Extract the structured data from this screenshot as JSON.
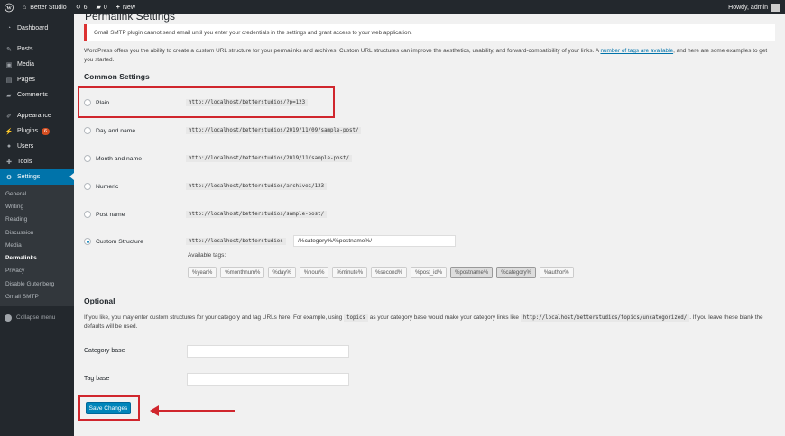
{
  "adminbar": {
    "site_name": "Better Studio",
    "updates_count": "6",
    "comments_count": "0",
    "new_label": "New",
    "howdy": "Howdy, admin"
  },
  "sidebar": {
    "items_top": [
      {
        "label": "Dashboard",
        "icon": "dashboard-icon"
      }
    ],
    "items_mid": [
      {
        "label": "Posts",
        "icon": "pin-icon"
      },
      {
        "label": "Media",
        "icon": "media-icon"
      },
      {
        "label": "Pages",
        "icon": "page-icon"
      },
      {
        "label": "Comments",
        "icon": "comment-icon"
      }
    ],
    "items_bottom": [
      {
        "label": "Appearance",
        "icon": "brush-icon"
      },
      {
        "label": "Plugins",
        "icon": "plugin-icon",
        "badge": "6"
      },
      {
        "label": "Users",
        "icon": "user-icon"
      },
      {
        "label": "Tools",
        "icon": "wrench-icon"
      },
      {
        "label": "Settings",
        "icon": "settings-icon"
      }
    ],
    "submenu": [
      "General",
      "Writing",
      "Reading",
      "Discussion",
      "Media",
      "Permalinks",
      "Privacy",
      "Disable Gutenberg",
      "Gmail SMTP"
    ],
    "current_submenu": "Permalinks",
    "collapse_label": "Collapse menu"
  },
  "content": {
    "title": "Permalink Settings",
    "notice": "Gmail SMTP plugin cannot send email until you enter your credentials in the settings and grant access to your web application.",
    "intro_before_link": "WordPress offers you the ability to create a custom URL structure for your permalinks and archives. Custom URL structures can improve the aesthetics, usability, and forward-compatibility of your links. A ",
    "intro_link": "number of tags are available",
    "intro_after_link": ", and here are some examples to get you started.",
    "common_heading": "Common Settings",
    "options": [
      {
        "label": "Plain",
        "example": "http://localhost/betterstudios/?p=123"
      },
      {
        "label": "Day and name",
        "example": "http://localhost/betterstudios/2019/11/09/sample-post/"
      },
      {
        "label": "Month and name",
        "example": "http://localhost/betterstudios/2019/11/sample-post/"
      },
      {
        "label": "Numeric",
        "example": "http://localhost/betterstudios/archives/123"
      },
      {
        "label": "Post name",
        "example": "http://localhost/betterstudios/sample-post/"
      },
      {
        "label": "Custom Structure",
        "example": "http://localhost/betterstudios"
      }
    ],
    "selected_option": "Custom Structure",
    "custom_structure_value": "/%category%/%postname%/",
    "available_tags_label": "Available tags:",
    "tags": [
      "%year%",
      "%monthnum%",
      "%day%",
      "%hour%",
      "%minute%",
      "%second%",
      "%post_id%",
      "%postname%",
      "%category%",
      "%author%"
    ],
    "active_tags": [
      "%postname%",
      "%category%"
    ],
    "optional_heading": "Optional",
    "optional_desc_1": "If you like, you may enter custom structures for your category and tag URLs here. For example, using ",
    "optional_code_1": "topics",
    "optional_desc_2": " as your category base would make your category links like ",
    "optional_code_2": "http://localhost/betterstudios/topics/uncategorized/",
    "optional_desc_3": ". If you leave these blank the defaults will be used.",
    "category_base_label": "Category base",
    "category_base_value": "",
    "tag_base_label": "Tag base",
    "tag_base_value": "",
    "save_label": "Save Changes"
  },
  "colors": {
    "accent": "#0073aa",
    "button": "#0085ba",
    "annotation": "#d0262d",
    "sidebar": "#23282d"
  }
}
